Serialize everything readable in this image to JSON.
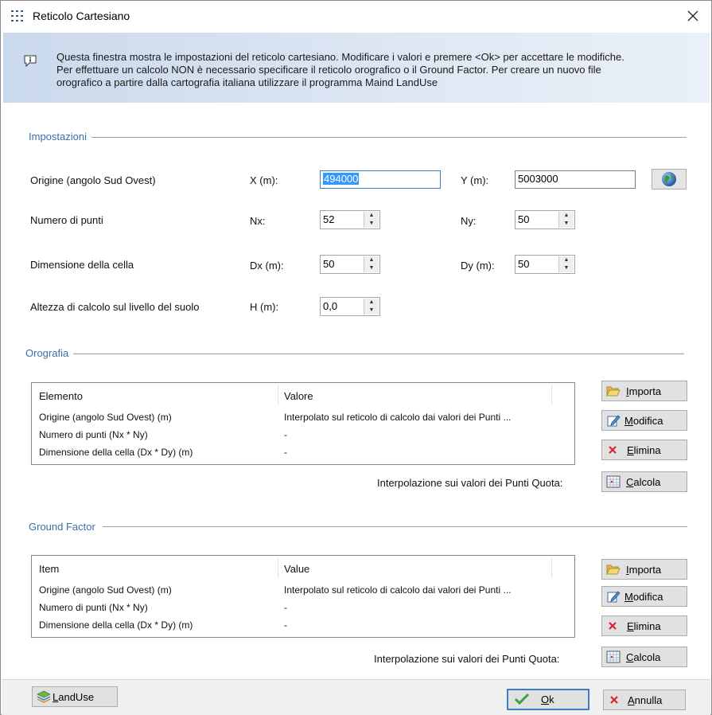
{
  "window": {
    "title": "Reticolo Cartesiano"
  },
  "info": {
    "line1": "Questa finestra mostra le impostazioni del reticolo cartesiano. Modificare i valori e premere <Ok> per accettare le modifiche.",
    "line2": "Per effettuare un calcolo NON è necessario specificare il reticolo orografico o il Ground Factor. Per creare un nuovo file",
    "line3": "orografico a partire dalla cartografia italiana utilizzare il programma Maind LandUse"
  },
  "impostazioni": {
    "group_label": "Impostazioni",
    "origin_label": "Origine (angolo Sud Ovest)",
    "x_label": "X (m):",
    "x_value": "494000",
    "y_label": "Y (m):",
    "y_value": "5003000",
    "points_label": "Numero di punti",
    "nx_label": "Nx:",
    "nx_value": "52",
    "ny_label": "Ny:",
    "ny_value": "50",
    "cell_label": "Dimensione della cella",
    "dx_label": "Dx (m):",
    "dx_value": "50",
    "dy_label": "Dy (m):",
    "dy_value": "50",
    "height_label": "Altezza di calcolo sul livello del suolo",
    "h_label": "H  (m):",
    "h_value": "0,0"
  },
  "orografia": {
    "group_label": "Orografia",
    "col1": "Elemento",
    "col2": "Valore",
    "rows": [
      {
        "name": "Origine (angolo Sud Ovest) (m)",
        "value": "Interpolato sul reticolo di calcolo dai valori dei Punti ..."
      },
      {
        "name": "Numero di punti (Nx * Ny)",
        "value": "-"
      },
      {
        "name": "Dimensione della cella (Dx * Dy) (m)",
        "value": "-"
      }
    ],
    "interp_label": "Interpolazione sui valori dei Punti Quota:"
  },
  "ground_factor": {
    "group_label": "Ground Factor",
    "col1": "Item",
    "col2": "Value",
    "rows": [
      {
        "name": "Origine (angolo Sud Ovest) (m)",
        "value": "Interpolato sul reticolo di calcolo dai valori dei Punti ..."
      },
      {
        "name": "Numero di punti (Nx * Ny)",
        "value": "-"
      },
      {
        "name": "Dimensione della cella (Dx * Dy) (m)",
        "value": "-"
      }
    ],
    "interp_label": "Interpolazione sui valori dei Punti Quota:"
  },
  "buttons": {
    "importa_u": "I",
    "importa_rest": "mporta",
    "modifica_u": "M",
    "modifica_rest": "odifica",
    "elimina_u": "E",
    "elimina_rest": "limina",
    "calcola_u": "C",
    "calcola_rest": "alcola",
    "landuse_u": "L",
    "landuse_rest": "andUse",
    "ok_u": "O",
    "ok_rest": "k",
    "annulla_u": "A",
    "annulla_rest": "nnulla"
  },
  "icons": [
    "grid-icon",
    "close-icon",
    "info-icon",
    "globe-icon",
    "folder-open-icon",
    "edit-icon",
    "delete-icon",
    "calculate-icon",
    "landuse-icon",
    "checkmark-icon"
  ]
}
